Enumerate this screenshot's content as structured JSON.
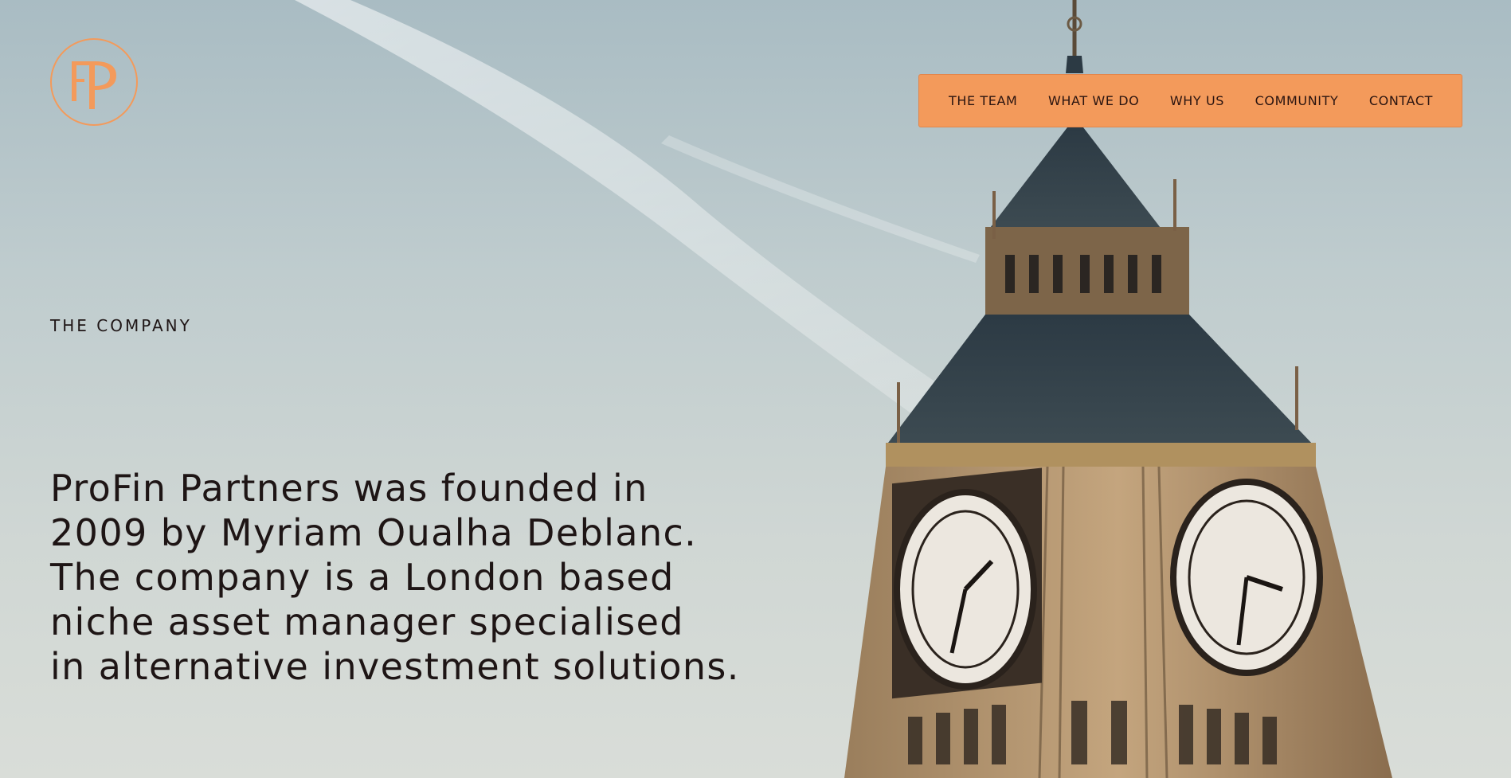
{
  "logo": {
    "monogram": "FP",
    "color": "#f39a5b"
  },
  "nav": {
    "background": "#f39a5b",
    "items": [
      "THE TEAM",
      "WHAT WE DO",
      "WHY US",
      "COMMUNITY",
      "CONTACT"
    ]
  },
  "section": {
    "eyebrow": "THE COMPANY"
  },
  "intro": {
    "lines": [
      "ProFin Partners was founded in",
      "2009 by Myriam Oualha Deblanc.",
      "The company is a London based",
      "niche asset manager specialised",
      "in alternative investment solutions."
    ]
  },
  "hero": {
    "subject": "clock-tower-photo"
  }
}
